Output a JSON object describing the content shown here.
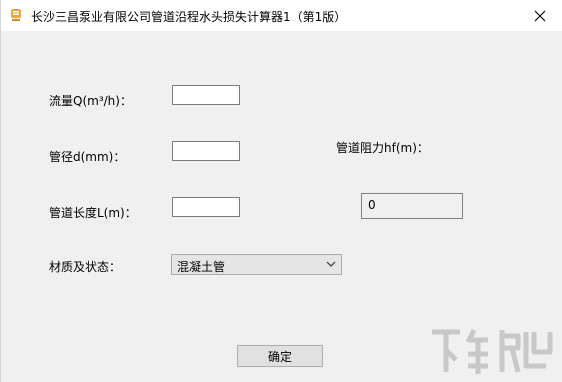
{
  "window": {
    "title": "长沙三昌泵业有限公司管道沿程水头损失计算器1（第1版）",
    "icon": "app-logo-icon",
    "close_icon": "close-icon"
  },
  "form": {
    "flow_label": "流量Q(m³/h)：",
    "flow_value": "",
    "diameter_label": "管径d(mm)：",
    "diameter_value": "",
    "length_label": "管道长度L(m)：",
    "length_value": "",
    "material_label": "材质及状态：",
    "material_selected": "混凝土管"
  },
  "result": {
    "label": "管道阻力hf(m)：",
    "value": "0"
  },
  "actions": {
    "confirm_label": "确定"
  },
  "watermark": {
    "text": "下载吧"
  }
}
